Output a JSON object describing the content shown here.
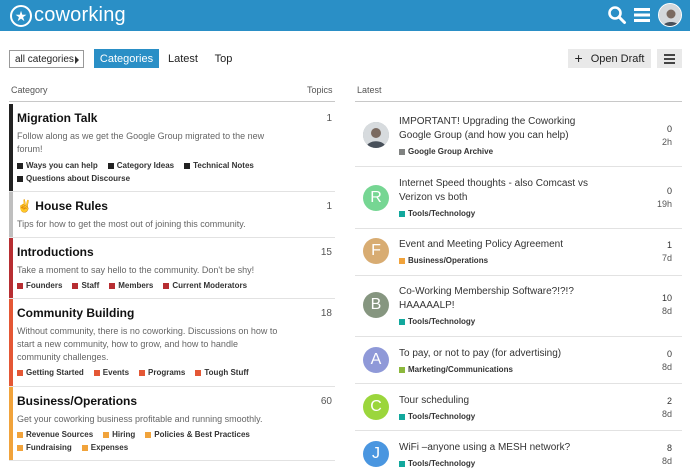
{
  "header": {
    "logo_text": "coworking",
    "accent": "#2a8fc6"
  },
  "toolbar": {
    "category_select": "all categories",
    "tabs": [
      "Categories",
      "Latest",
      "Top"
    ],
    "open_draft": "Open Draft"
  },
  "columns": {
    "category": "Category",
    "topics": "Topics",
    "latest": "Latest"
  },
  "categories": [
    {
      "name": "Migration Talk",
      "count": "1",
      "color": "#222222",
      "desc": "Follow along as we get the Google Group migrated to the new forum!",
      "subs": [
        {
          "label": "Ways you can help",
          "color": "#222222"
        },
        {
          "label": "Category Ideas",
          "color": "#222222"
        },
        {
          "label": "Technical Notes",
          "color": "#222222"
        },
        {
          "label": "Questions about Discourse",
          "color": "#222222"
        }
      ]
    },
    {
      "name": "House Rules",
      "emoji": "✌",
      "count": "1",
      "color": "#bfbfbf",
      "desc": "Tips for how to get the most out of joining this community.",
      "subs": []
    },
    {
      "name": "Introductions",
      "count": "15",
      "color": "#b72e32",
      "desc": "Take a moment to say hello to the community. Don't be shy!",
      "subs": [
        {
          "label": "Founders",
          "color": "#b72e32"
        },
        {
          "label": "Staff",
          "color": "#b72e32"
        },
        {
          "label": "Members",
          "color": "#b72e32"
        },
        {
          "label": "Current Moderators",
          "color": "#b72e32"
        }
      ]
    },
    {
      "name": "Community Building",
      "count": "18",
      "color": "#e45735",
      "desc": "Without community, there is no coworking. Discussions on how to start a new community, how to grow, and how to handle community challenges.",
      "subs": [
        {
          "label": "Getting Started",
          "color": "#e45735"
        },
        {
          "label": "Events",
          "color": "#e45735"
        },
        {
          "label": "Programs",
          "color": "#e45735"
        },
        {
          "label": "Tough Stuff",
          "color": "#e45735"
        }
      ]
    },
    {
      "name": "Business/Operations",
      "count": "60",
      "color": "#f1a33b",
      "desc": "Get your coworking business profitable and running smoothly.",
      "subs": [
        {
          "label": "Revenue Sources",
          "color": "#f1a33b"
        },
        {
          "label": "Hiring",
          "color": "#f1a33b"
        },
        {
          "label": "Policies & Best Practices",
          "color": "#f1a33b"
        },
        {
          "label": "Fundraising",
          "color": "#f1a33b"
        },
        {
          "label": "Expenses",
          "color": "#f1a33b"
        }
      ]
    }
  ],
  "topics": [
    {
      "title": "IMPORTANT! Upgrading the Coworking Google Group (and how you can help)",
      "category": "Google Group Archive",
      "cat_color": "#808281",
      "posts": "0",
      "age": "2h",
      "avatar_letter": "",
      "avatar_color": "#a9b2b6"
    },
    {
      "title": "Internet Speed thoughts - also Comcast vs Verizon vs both",
      "category": "Tools/Technology",
      "cat_color": "#12a89d",
      "posts": "0",
      "age": "19h",
      "avatar_letter": "R",
      "avatar_color": "#76d693"
    },
    {
      "title": "Event and Meeting Policy Agreement",
      "category": "Business/Operations",
      "cat_color": "#f1a33b",
      "posts": "1",
      "age": "7d",
      "avatar_letter": "F",
      "avatar_color": "#d8ac72"
    },
    {
      "title": "Co-Working Membership Software?!?!? HAAAAALP!",
      "category": "Tools/Technology",
      "cat_color": "#12a89d",
      "posts": "10",
      "age": "8d",
      "avatar_letter": "B",
      "avatar_color": "#869680"
    },
    {
      "title": "To pay, or not to pay (for advertising)",
      "category": "Marketing/Communications",
      "cat_color": "#8cb83c",
      "posts": "0",
      "age": "8d",
      "avatar_letter": "A",
      "avatar_color": "#8f99d8"
    },
    {
      "title": "Tour scheduling",
      "category": "Tools/Technology",
      "cat_color": "#12a89d",
      "posts": "2",
      "age": "8d",
      "avatar_letter": "C",
      "avatar_color": "#9bd63c"
    },
    {
      "title": "WiFi –anyone using a MESH network?",
      "category": "Tools/Technology",
      "cat_color": "#12a89d",
      "posts": "8",
      "age": "8d",
      "avatar_letter": "J",
      "avatar_color": "#4a96e0"
    }
  ]
}
